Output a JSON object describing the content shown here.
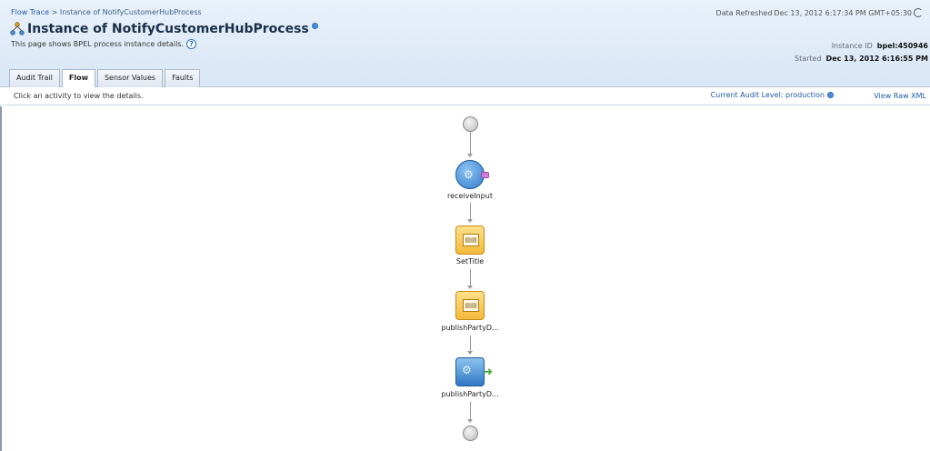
{
  "breadcrumb": {
    "root": "Flow Trace",
    "separator": " > ",
    "current": "Instance of NotifyCustomerHubProcess"
  },
  "refresh": {
    "label": "Data Refreshed",
    "timestamp": "Dec 13, 2012 6:17:34 PM GMT+05:30"
  },
  "page": {
    "title": "Instance of NotifyCustomerHubProcess",
    "subtitle": "This page shows BPEL process instance details.",
    "help_glyph": "?"
  },
  "instance": {
    "id_label": "Instance ID",
    "id_value": "bpel:450946",
    "started_label": "Started",
    "started_value": "Dec 13, 2012 6:16:55 PM"
  },
  "tabs": [
    {
      "label": "Audit Trail",
      "active": false
    },
    {
      "label": "Flow",
      "active": true
    },
    {
      "label": "Sensor Values",
      "active": false
    },
    {
      "label": "Faults",
      "active": false
    }
  ],
  "toolbar": {
    "hint": "Click an activity to view the details.",
    "audit_level": "Current Audit Level: production",
    "view_raw": "View Raw XML"
  },
  "flow": {
    "nodes": [
      {
        "kind": "start",
        "label": ""
      },
      {
        "kind": "receive",
        "label": "receiveInput",
        "icon": "gear-icon"
      },
      {
        "kind": "assign",
        "label": "SetTitle",
        "icon": "assign-icon"
      },
      {
        "kind": "assign",
        "label": "publishPartyD...",
        "icon": "assign-icon"
      },
      {
        "kind": "invoke",
        "label": "publishPartyD...",
        "icon": "gear-icon"
      },
      {
        "kind": "end",
        "label": ""
      }
    ]
  },
  "colors": {
    "header_bg": "#d8e6f5",
    "link": "#1f5aa6",
    "receive_node": "#2f7cc9",
    "assign_node": "#f5b93a",
    "invoke_node": "#2f78c4"
  }
}
